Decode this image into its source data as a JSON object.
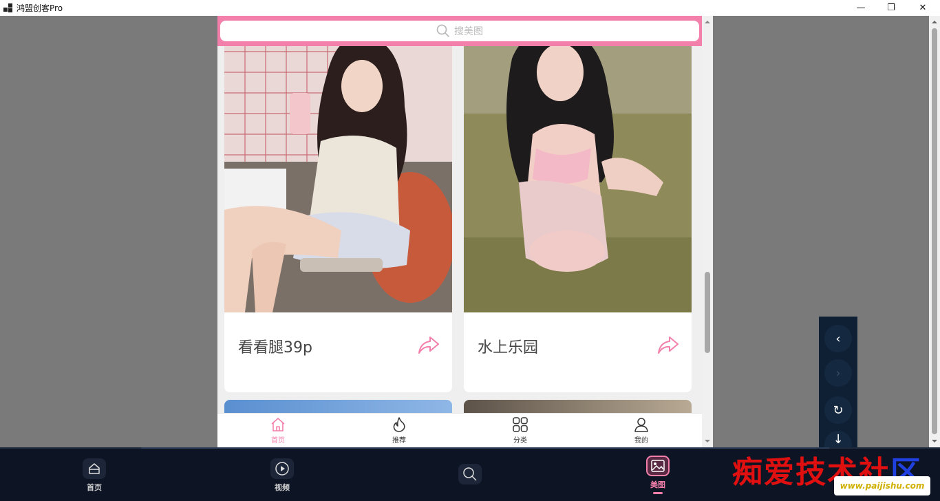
{
  "window": {
    "title": "鸿盟创客Pro",
    "minimize": "—",
    "maximize": "❐",
    "close": "✕"
  },
  "search": {
    "placeholder": "搜美图"
  },
  "cards": [
    {
      "caption": "看看腿39p"
    },
    {
      "caption": "水上乐园"
    }
  ],
  "tabs": [
    {
      "label": "首页",
      "icon": "home-icon",
      "active": true
    },
    {
      "label": "推荐",
      "icon": "flame-icon",
      "active": false
    },
    {
      "label": "分类",
      "icon": "grid-icon",
      "active": false
    },
    {
      "label": "我的",
      "icon": "user-icon",
      "active": false
    }
  ],
  "side_nav": {
    "back": "‹",
    "forward": "›",
    "reload": "↻",
    "down": "↓"
  },
  "bottom_nav": [
    {
      "label": "首页",
      "icon": "home-icon"
    },
    {
      "label": "视频",
      "icon": "play-icon"
    },
    {
      "label": "",
      "icon": "search-icon"
    },
    {
      "label": "美图",
      "icon": "image-icon",
      "active": true
    }
  ],
  "watermark": {
    "text_red": "痴爱技术社",
    "text_blue": "区",
    "url": "www.paijishu.com"
  },
  "colors": {
    "accent": "#f280ab",
    "dark_nav": "#0d1424"
  }
}
